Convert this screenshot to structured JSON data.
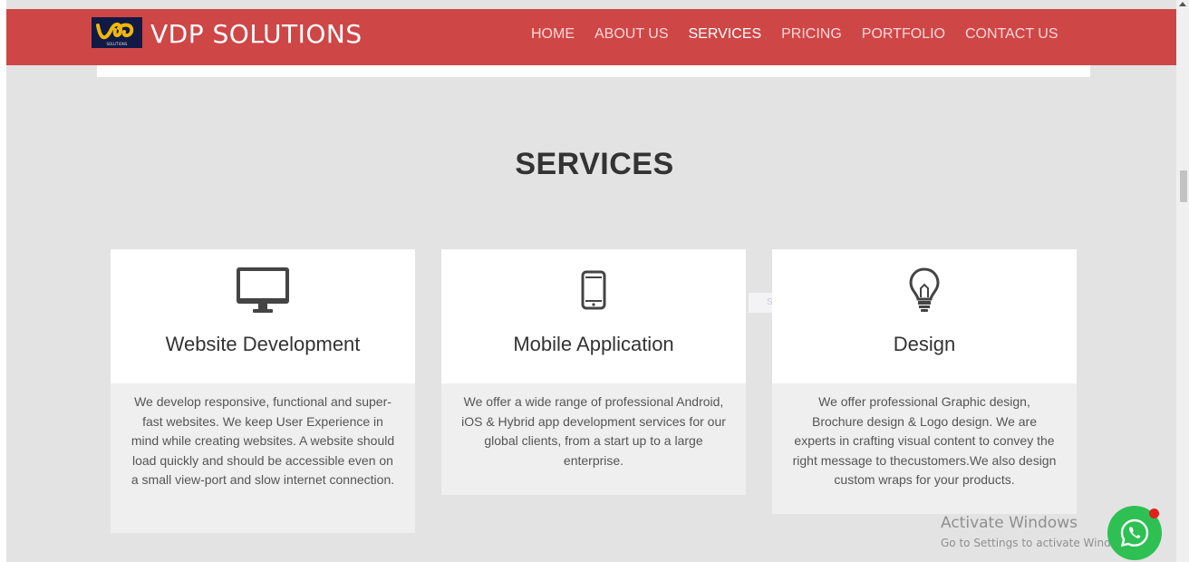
{
  "brand": {
    "name": "VDP SOLUTIONS",
    "logo_tag": "SOLUTIONS"
  },
  "nav": [
    {
      "label": "HOME",
      "active": false
    },
    {
      "label": "ABOUT US",
      "active": false
    },
    {
      "label": "SERVICES",
      "active": true
    },
    {
      "label": "PRICING",
      "active": false
    },
    {
      "label": "PORTFOLIO",
      "active": false
    },
    {
      "label": "CONTACT US",
      "active": false
    }
  ],
  "section": {
    "title": "SERVICES"
  },
  "services": [
    {
      "icon": "monitor-icon",
      "title": "Website Development",
      "description": "We develop responsive, functional and super-fast websites. We keep User Experience in mind while creating websites. A website should load quickly and should be accessible even on a small view-port and slow internet connection."
    },
    {
      "icon": "mobile-icon",
      "title": "Mobile Application",
      "description": "We offer a wide range of professional Android, iOS & Hybrid app development services for our global clients, from a start up to a large enterprise."
    },
    {
      "icon": "lightbulb-icon",
      "title": "Design",
      "description": "We offer professional Graphic design, Brochure design & Logo design. We are experts in crafting visual content to convey the right message to thecustomers.We also design custom wraps for your products."
    }
  ],
  "ghost_text": "Software Shop",
  "windows_notice": {
    "title": "Activate Windows",
    "subtitle": "Go to Settings to activate Windows."
  },
  "colors": {
    "navbar": "#cf4646",
    "page_bg": "#e3e3e3",
    "whatsapp": "#2ec053",
    "badge": "#e0201a"
  },
  "whatsapp": {
    "icon": "whatsapp-icon"
  }
}
